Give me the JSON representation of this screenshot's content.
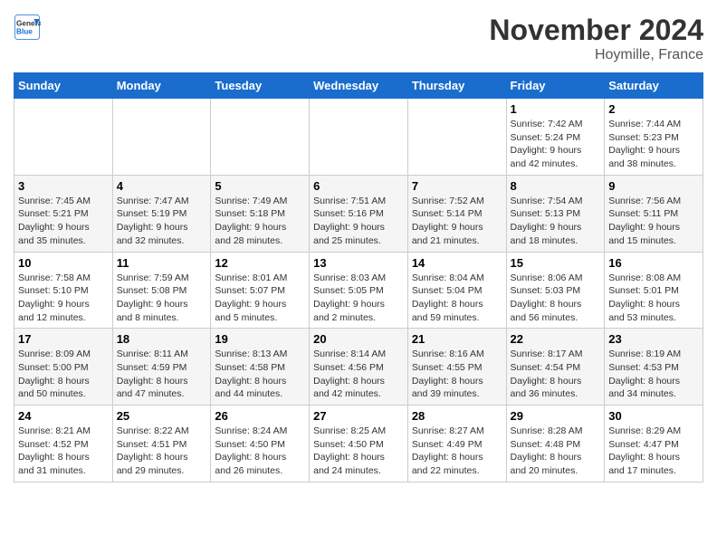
{
  "header": {
    "logo_line1": "General",
    "logo_line2": "Blue",
    "month_title": "November 2024",
    "location": "Hoymille, France"
  },
  "days_of_week": [
    "Sunday",
    "Monday",
    "Tuesday",
    "Wednesday",
    "Thursday",
    "Friday",
    "Saturday"
  ],
  "weeks": [
    [
      {
        "day": "",
        "info": ""
      },
      {
        "day": "",
        "info": ""
      },
      {
        "day": "",
        "info": ""
      },
      {
        "day": "",
        "info": ""
      },
      {
        "day": "",
        "info": ""
      },
      {
        "day": "1",
        "info": "Sunrise: 7:42 AM\nSunset: 5:24 PM\nDaylight: 9 hours\nand 42 minutes."
      },
      {
        "day": "2",
        "info": "Sunrise: 7:44 AM\nSunset: 5:23 PM\nDaylight: 9 hours\nand 38 minutes."
      }
    ],
    [
      {
        "day": "3",
        "info": "Sunrise: 7:45 AM\nSunset: 5:21 PM\nDaylight: 9 hours\nand 35 minutes."
      },
      {
        "day": "4",
        "info": "Sunrise: 7:47 AM\nSunset: 5:19 PM\nDaylight: 9 hours\nand 32 minutes."
      },
      {
        "day": "5",
        "info": "Sunrise: 7:49 AM\nSunset: 5:18 PM\nDaylight: 9 hours\nand 28 minutes."
      },
      {
        "day": "6",
        "info": "Sunrise: 7:51 AM\nSunset: 5:16 PM\nDaylight: 9 hours\nand 25 minutes."
      },
      {
        "day": "7",
        "info": "Sunrise: 7:52 AM\nSunset: 5:14 PM\nDaylight: 9 hours\nand 21 minutes."
      },
      {
        "day": "8",
        "info": "Sunrise: 7:54 AM\nSunset: 5:13 PM\nDaylight: 9 hours\nand 18 minutes."
      },
      {
        "day": "9",
        "info": "Sunrise: 7:56 AM\nSunset: 5:11 PM\nDaylight: 9 hours\nand 15 minutes."
      }
    ],
    [
      {
        "day": "10",
        "info": "Sunrise: 7:58 AM\nSunset: 5:10 PM\nDaylight: 9 hours\nand 12 minutes."
      },
      {
        "day": "11",
        "info": "Sunrise: 7:59 AM\nSunset: 5:08 PM\nDaylight: 9 hours\nand 8 minutes."
      },
      {
        "day": "12",
        "info": "Sunrise: 8:01 AM\nSunset: 5:07 PM\nDaylight: 9 hours\nand 5 minutes."
      },
      {
        "day": "13",
        "info": "Sunrise: 8:03 AM\nSunset: 5:05 PM\nDaylight: 9 hours\nand 2 minutes."
      },
      {
        "day": "14",
        "info": "Sunrise: 8:04 AM\nSunset: 5:04 PM\nDaylight: 8 hours\nand 59 minutes."
      },
      {
        "day": "15",
        "info": "Sunrise: 8:06 AM\nSunset: 5:03 PM\nDaylight: 8 hours\nand 56 minutes."
      },
      {
        "day": "16",
        "info": "Sunrise: 8:08 AM\nSunset: 5:01 PM\nDaylight: 8 hours\nand 53 minutes."
      }
    ],
    [
      {
        "day": "17",
        "info": "Sunrise: 8:09 AM\nSunset: 5:00 PM\nDaylight: 8 hours\nand 50 minutes."
      },
      {
        "day": "18",
        "info": "Sunrise: 8:11 AM\nSunset: 4:59 PM\nDaylight: 8 hours\nand 47 minutes."
      },
      {
        "day": "19",
        "info": "Sunrise: 8:13 AM\nSunset: 4:58 PM\nDaylight: 8 hours\nand 44 minutes."
      },
      {
        "day": "20",
        "info": "Sunrise: 8:14 AM\nSunset: 4:56 PM\nDaylight: 8 hours\nand 42 minutes."
      },
      {
        "day": "21",
        "info": "Sunrise: 8:16 AM\nSunset: 4:55 PM\nDaylight: 8 hours\nand 39 minutes."
      },
      {
        "day": "22",
        "info": "Sunrise: 8:17 AM\nSunset: 4:54 PM\nDaylight: 8 hours\nand 36 minutes."
      },
      {
        "day": "23",
        "info": "Sunrise: 8:19 AM\nSunset: 4:53 PM\nDaylight: 8 hours\nand 34 minutes."
      }
    ],
    [
      {
        "day": "24",
        "info": "Sunrise: 8:21 AM\nSunset: 4:52 PM\nDaylight: 8 hours\nand 31 minutes."
      },
      {
        "day": "25",
        "info": "Sunrise: 8:22 AM\nSunset: 4:51 PM\nDaylight: 8 hours\nand 29 minutes."
      },
      {
        "day": "26",
        "info": "Sunrise: 8:24 AM\nSunset: 4:50 PM\nDaylight: 8 hours\nand 26 minutes."
      },
      {
        "day": "27",
        "info": "Sunrise: 8:25 AM\nSunset: 4:50 PM\nDaylight: 8 hours\nand 24 minutes."
      },
      {
        "day": "28",
        "info": "Sunrise: 8:27 AM\nSunset: 4:49 PM\nDaylight: 8 hours\nand 22 minutes."
      },
      {
        "day": "29",
        "info": "Sunrise: 8:28 AM\nSunset: 4:48 PM\nDaylight: 8 hours\nand 20 minutes."
      },
      {
        "day": "30",
        "info": "Sunrise: 8:29 AM\nSunset: 4:47 PM\nDaylight: 8 hours\nand 17 minutes."
      }
    ]
  ]
}
